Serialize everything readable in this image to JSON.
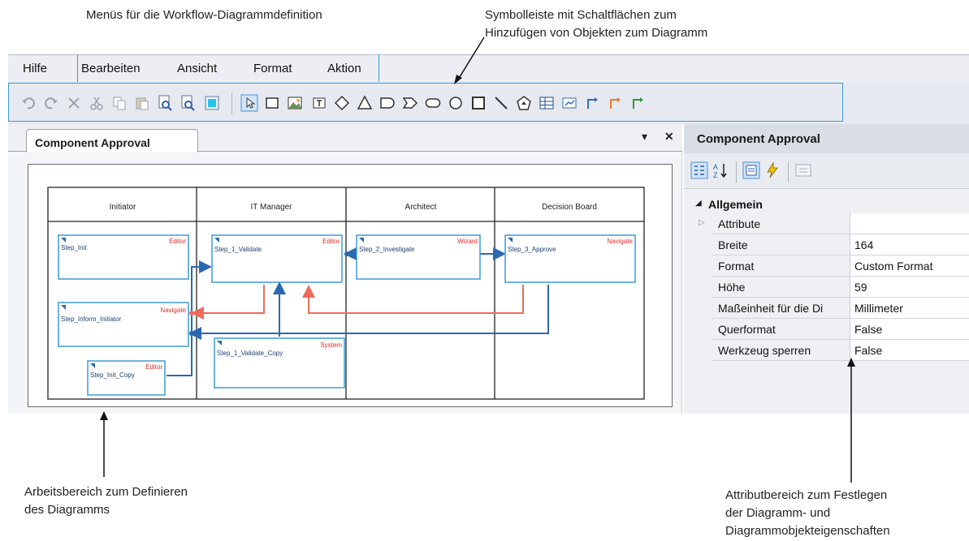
{
  "annotations": {
    "menus": "Menüs für die Workflow-Diagrammdefinition",
    "toolbar_line1": "Symbolleiste mit Schaltflächen zum",
    "toolbar_line2": "Hinzufügen von Objekten zum Diagramm",
    "workspace_line1": "Arbeitsbereich zum Definieren",
    "workspace_line2": "des Diagramms",
    "attributes_line1": "Attributbereich zum Festlegen",
    "attributes_line2": "der Diagramm- und",
    "attributes_line3": "Diagrammobjekteigenschaften"
  },
  "menu": {
    "help": "Hilfe",
    "edit": "Bearbeiten",
    "view": "Ansicht",
    "format": "Format",
    "action": "Aktion"
  },
  "toolbar_icons": [
    "undo-icon",
    "redo-icon",
    "delete-icon",
    "cut-icon",
    "copy-icon",
    "paste-icon",
    "find-icon",
    "replace-icon",
    "color-icon",
    "pointer-icon",
    "rectangle-icon",
    "image-icon",
    "textbox-icon",
    "diamond-icon",
    "triangle-icon",
    "delay-icon",
    "display-icon",
    "terminator-icon",
    "circle-icon",
    "square-icon",
    "line-icon",
    "shape-icon",
    "table-icon",
    "chart-icon",
    "connector-blue-icon",
    "connector-orange-icon",
    "connector-green-icon"
  ],
  "document": {
    "tab_title": "Component Approval",
    "pin": "▾",
    "close": "✕"
  },
  "diagram": {
    "lanes": [
      "Initiator",
      "IT Manager",
      "Architect",
      "Decision Board"
    ],
    "nodes": [
      {
        "name": "Step_Init",
        "tag": "Editor"
      },
      {
        "name": "Step_Inform_Initiator",
        "tag": "Navigate"
      },
      {
        "name": "Step_Init_Copy",
        "tag": "Editor"
      },
      {
        "name": "Step_1_Validate",
        "tag": "Editor"
      },
      {
        "name": "Step_1_Validate_Copy",
        "tag": "System"
      },
      {
        "name": "Step_2_Investigate",
        "tag": "Wizard"
      },
      {
        "name": "Step_3_Approve",
        "tag": "Navigate"
      }
    ],
    "colors": {
      "box": "#3b9bd8",
      "blue_line": "#2a68b4",
      "red_line": "#ee6b5a",
      "tag": "#d9302b"
    }
  },
  "properties": {
    "title": "Component Approval",
    "group": "Allgemein",
    "rows": [
      {
        "key": "Attribute",
        "value": ""
      },
      {
        "key": "Breite",
        "value": "164"
      },
      {
        "key": "Format",
        "value": "Custom Format"
      },
      {
        "key": "Höhe",
        "value": "59"
      },
      {
        "key": "Maßeinheit für die Di",
        "value": "Millimeter"
      },
      {
        "key": "Querformat",
        "value": "False"
      },
      {
        "key": "Werkzeug sperren",
        "value": "False"
      }
    ]
  },
  "colors": {
    "accent": "#3b9bd8",
    "menubar": "#eceef3",
    "toolbar": "#e6e9ef"
  }
}
